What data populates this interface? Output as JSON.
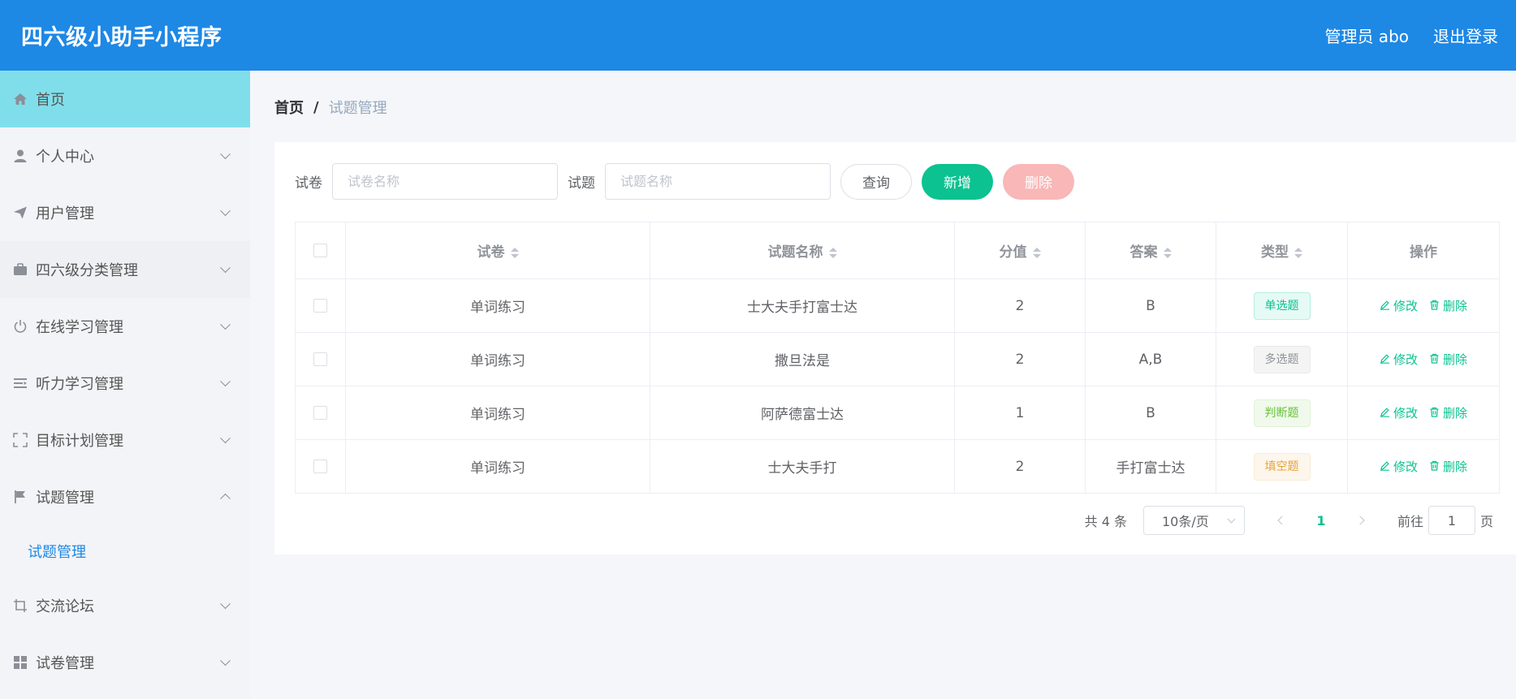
{
  "header": {
    "title": "四六级小助手小程序",
    "user": "管理员 abo",
    "logout": "退出登录"
  },
  "sidebar": {
    "items": [
      {
        "label": "首页",
        "icon": "home-icon"
      },
      {
        "label": "个人中心",
        "icon": "user-icon"
      },
      {
        "label": "用户管理",
        "icon": "send-icon"
      },
      {
        "label": "四六级分类管理",
        "icon": "briefcase-icon"
      },
      {
        "label": "在线学习管理",
        "icon": "power-icon"
      },
      {
        "label": "听力学习管理",
        "icon": "list-icon"
      },
      {
        "label": "目标计划管理",
        "icon": "fullscreen-icon"
      },
      {
        "label": "试题管理",
        "icon": "flag-icon"
      },
      {
        "label": "交流论坛",
        "icon": "crop-icon"
      },
      {
        "label": "试卷管理",
        "icon": "grid-icon"
      }
    ],
    "submenu": {
      "label": "试题管理"
    }
  },
  "breadcrumb": {
    "home": "首页",
    "separator": "/",
    "current": "试题管理"
  },
  "search": {
    "paper_label": "试卷",
    "paper_placeholder": "试卷名称",
    "question_label": "试题",
    "question_placeholder": "试题名称",
    "query_btn": "查询",
    "add_btn": "新增",
    "delete_btn": "删除"
  },
  "table": {
    "headers": [
      "试卷",
      "试题名称",
      "分值",
      "答案",
      "类型",
      "操作"
    ],
    "edit_label": "修改",
    "delete_label": "删除",
    "rows": [
      {
        "paper": "单词练习",
        "name": "士大夫手打富士达",
        "score": "2",
        "answer": "B",
        "type": "单选题"
      },
      {
        "paper": "单词练习",
        "name": "撒旦法是",
        "score": "2",
        "answer": "A,B",
        "type": "多选题"
      },
      {
        "paper": "单词练习",
        "name": "阿萨德富士达",
        "score": "1",
        "answer": "B",
        "type": "判断题"
      },
      {
        "paper": "单词练习",
        "name": "士大夫手打",
        "score": "2",
        "answer": "手打富士达",
        "type": "填空题"
      }
    ]
  },
  "tag_colors": {
    "单选题": {
      "bg": "#e6faf5",
      "border": "#b3f0df",
      "color": "#0bc290"
    },
    "多选题": {
      "bg": "#f4f4f5",
      "border": "#e9e9eb",
      "color": "#909399"
    },
    "判断题": {
      "bg": "#f0f9eb",
      "border": "#e1f3d8",
      "color": "#67c23a"
    },
    "填空题": {
      "bg": "#fdf6ec",
      "border": "#faecd8",
      "color": "#e6a23c"
    }
  },
  "pagination": {
    "total": "共 4 条",
    "page_size": "10条/页",
    "current": "1",
    "goto_prefix": "前往",
    "goto_value": "1",
    "goto_suffix": "页"
  },
  "colors": {
    "header": "#1e88e5",
    "accent": "#0bc290",
    "active_menu": "#80deea"
  }
}
